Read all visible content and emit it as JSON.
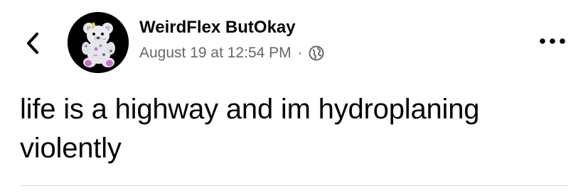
{
  "post": {
    "author_name": "WeirdFlex ButOkay",
    "timestamp": "August 19 at 12:54 PM",
    "separator": "·",
    "audience_icon": "globe-icon",
    "text": "life is a highway and im hydroplaning violently"
  },
  "header": {
    "back_icon": "chevron-left-icon",
    "more_icon": "more-horizontal-icon",
    "avatar_image": "teddy-bear-avatar"
  },
  "colors": {
    "text_primary": "#050505",
    "text_secondary": "#65676b",
    "avatar_background": "#000000",
    "divider": "#d8d8d8"
  }
}
